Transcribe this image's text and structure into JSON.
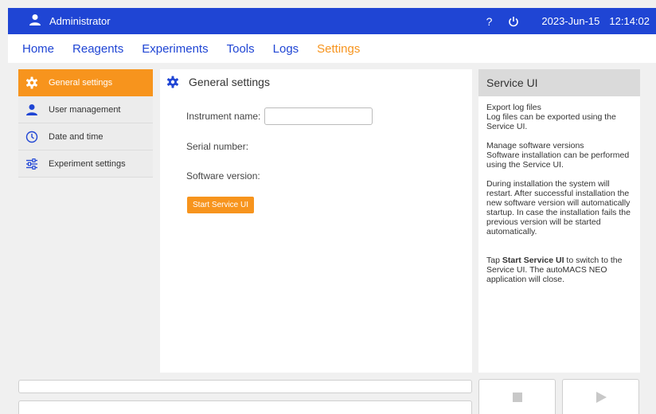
{
  "topbar": {
    "user": "Administrator",
    "help": "?",
    "date": "2023-Jun-15",
    "time": "12:14:02"
  },
  "nav": {
    "tabs": [
      "Home",
      "Reagents",
      "Experiments",
      "Tools",
      "Logs",
      "Settings"
    ],
    "active": "Settings"
  },
  "sidemenu": {
    "items": [
      {
        "label": "General settings",
        "icon": "gear-icon"
      },
      {
        "label": "User management",
        "icon": "person-icon"
      },
      {
        "label": "Date and time",
        "icon": "clock-icon"
      },
      {
        "label": "Experiment settings",
        "icon": "sliders-icon"
      }
    ]
  },
  "main": {
    "title": "General settings",
    "instrument_name_label": "Instrument name:",
    "instrument_name_value": "",
    "serial_label": "Serial number:",
    "software_label": "Software version:",
    "start_button": "Start Service UI"
  },
  "info": {
    "title": "Service UI",
    "export_heading": "Export log files",
    "export_text": "Log files can be exported using the Service UI.",
    "manage_heading": "Manage software versions",
    "manage_text": "Software installation can be performed using the Service UI.",
    "install_text": "During installation the system will restart. After successful installation the new software version will automatically startup. In case the installation fails the previous version will be started automatically.",
    "tap_prefix": "Tap ",
    "tap_strong": "Start Service UI",
    "tap_suffix": " to switch to the Service UI. The autoMACS NEO application will close."
  },
  "colors": {
    "topbar": "#1f45d4",
    "accent": "#f7941d"
  }
}
